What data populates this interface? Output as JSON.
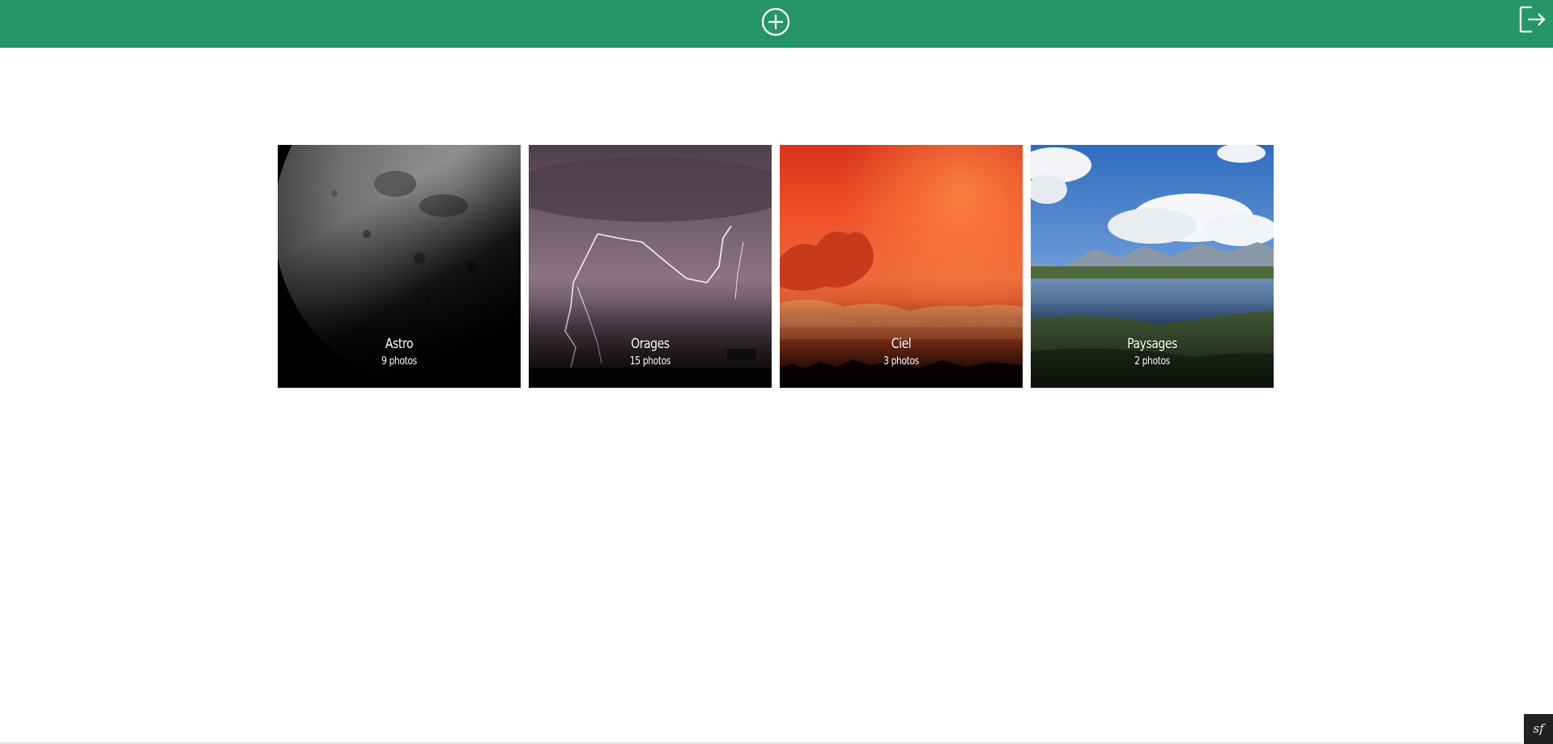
{
  "header": {
    "add_icon": "plus-circle-icon",
    "logout_icon": "logout-icon",
    "color": "#27956c"
  },
  "albums": [
    {
      "title": "Astro",
      "count": "9 photos",
      "image": "moon-image"
    },
    {
      "title": "Orages",
      "count": "15 photos",
      "image": "lightning-image"
    },
    {
      "title": "Ciel",
      "count": "3 photos",
      "image": "red-sky-image"
    },
    {
      "title": "Paysages",
      "count": "2 photos",
      "image": "lake-landscape-image"
    }
  ],
  "toolbar": {
    "label": "sf"
  }
}
